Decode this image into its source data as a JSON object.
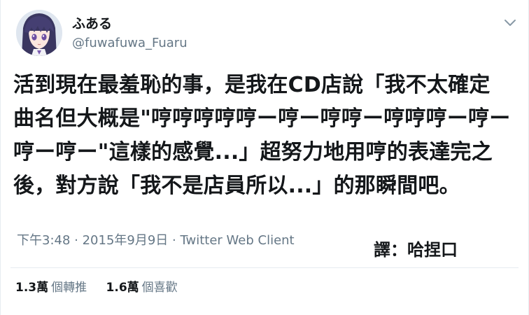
{
  "author": {
    "display_name": "ふある",
    "handle": "@fuwafuwa_Fuaru",
    "avatar_icon": "anime-avatar-icon"
  },
  "menu": {
    "icon": "chevron-down-icon"
  },
  "tweet": {
    "lines": [
      "活到現在最羞恥的事，是我在CD店說「我不太確定",
      "曲名但大概是\"哼哼哼哼哼ー哼ー哼哼ー哼哼哼ー哼ー",
      "哼ー哼ー\"這樣的感覺...」超努力地用哼的表達完之",
      "後，對方說「我不是店員所以...」的那瞬間吧。"
    ],
    "time": "下午3:48",
    "separator1": " · ",
    "date": "2015年9月9日",
    "separator2": " · ",
    "client": "Twitter Web Client"
  },
  "credit": "譯：哈捏口",
  "stats": {
    "retweets_count": "1.3萬",
    "retweets_label": "個轉推",
    "likes_count": "1.6萬",
    "likes_label": "個喜歡"
  },
  "colors": {
    "text": "#14171a",
    "secondary": "#657786",
    "divider": "#e6ecf0",
    "avatar_hair": "#3a3660"
  }
}
